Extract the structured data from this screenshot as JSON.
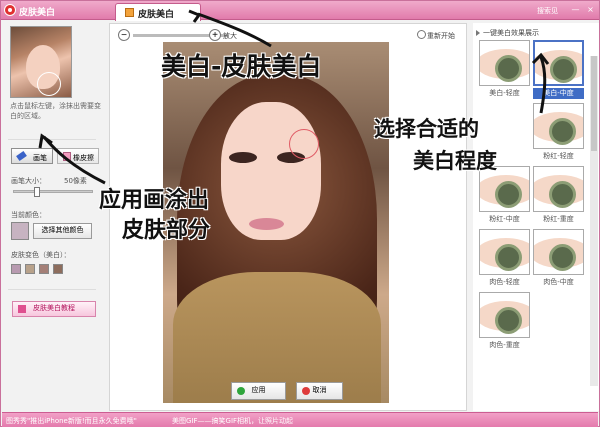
{
  "window": {
    "title": "皮肤美白",
    "help": "搜索见",
    "minimize": "—",
    "close": "×"
  },
  "tab": {
    "label": "皮肤美白"
  },
  "left_panel": {
    "instruction": "点击鼠标左键，涂抹出需要变白的区域。",
    "brush_label": "画笔",
    "eraser_label": "橡皮擦",
    "brush_size_label": "画笔大小：",
    "brush_size_value": "50像素",
    "current_color_label": "当前颜色：",
    "choose_color_button": "选择其他颜色",
    "skin_colors_label": "皮肤变色（美白）：",
    "tutorial_button": "皮肤美白教程",
    "swatch_colors": [
      "#b89ab0",
      "#b8a28b",
      "#a47f77",
      "#8d6d5d"
    ]
  },
  "center": {
    "zoom_label": "放大",
    "reset_label": "重新开始",
    "apply_button": "应用",
    "cancel_button": "取消"
  },
  "right_panel": {
    "title": "一键美白效果展示",
    "presets": [
      {
        "label": "美白-轻度",
        "selected": false
      },
      {
        "label": "美白-中度",
        "selected": true
      },
      {
        "label": "粉红-轻度",
        "selected": false
      },
      {
        "label": "粉红-中度",
        "selected": false
      },
      {
        "label": "粉红-重度",
        "selected": false
      },
      {
        "label": "肉色-轻度",
        "selected": false
      },
      {
        "label": "肉色-中度",
        "selected": false
      },
      {
        "label": "肉色-重度",
        "selected": false
      }
    ]
  },
  "annotations": {
    "top": "美白-皮肤美白",
    "right_line1": "选择合适的",
    "right_line2": "美白程度",
    "left_line1": "应用画涂出",
    "left_line2": "皮肤部分"
  },
  "status_bar": {
    "message_left": "图秀秀\"推出iPhone新版!而且永久免费哦\"",
    "message_right": "美图GIF——搞笑GIF相机，让照片动起"
  }
}
